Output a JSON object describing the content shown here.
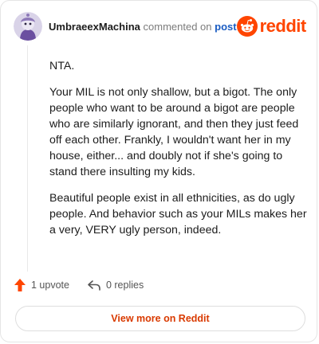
{
  "header": {
    "username": "UmbraeexMachina",
    "action": "commented on",
    "post_link": "post",
    "brand": "reddit"
  },
  "comment": {
    "paragraphs": [
      "NTA.",
      "Your MIL is not only shallow, but a bigot. The only people who want to be around a bigot are people who are similarly ignorant, and then they just feed off each other. Frankly, I wouldn't want her in my house, either... and doubly not if she's going to stand there insulting my kids.",
      "Beautiful people exist in all ethnicities, as do ugly people. And behavior such as your MILs makes her a very, VERY ugly person, indeed."
    ]
  },
  "footer": {
    "upvotes": "1 upvote",
    "replies": "0 replies",
    "view_more": "View more on Reddit"
  },
  "colors": {
    "brand": "#ff4500",
    "link": "#1a5cc2",
    "view_more": "#d93a00"
  }
}
